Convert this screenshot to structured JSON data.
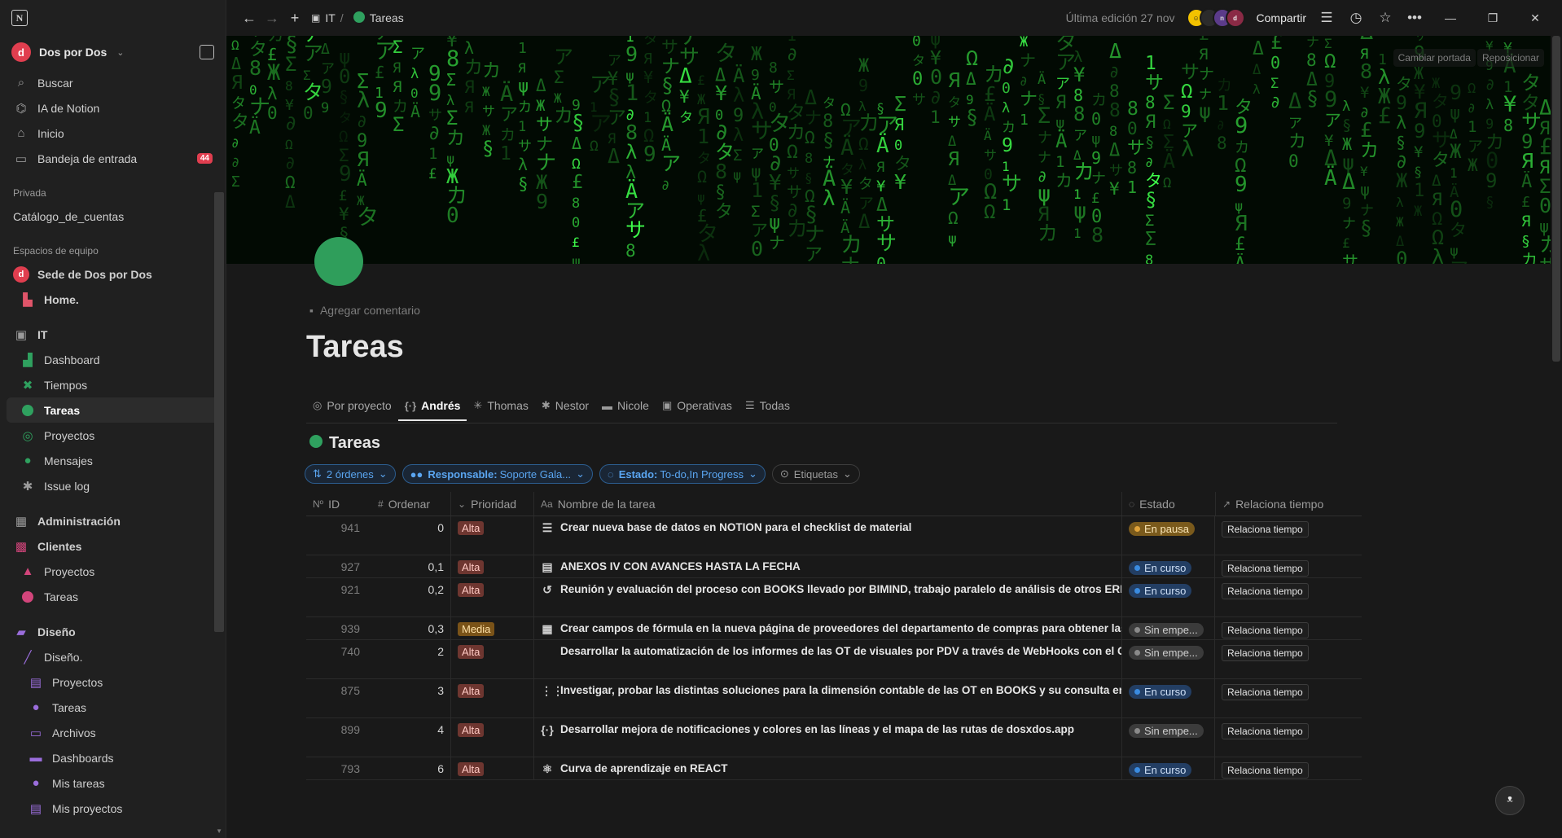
{
  "sidebar": {
    "workspace": "Dos por Dos",
    "top_items": [
      {
        "label": "Buscar",
        "icon": "search-icon"
      },
      {
        "label": "IA de Notion",
        "icon": "ai-icon"
      },
      {
        "label": "Inicio",
        "icon": "home-icon"
      },
      {
        "label": "Bandeja de entrada",
        "icon": "inbox-icon",
        "badge": "44"
      }
    ],
    "private_heading": "Privada",
    "private_items": [
      {
        "label": "Catálogo_de_cuentas"
      }
    ],
    "team_heading": "Espacios de equipo",
    "team_space": "Sede de Dos por Dos",
    "home_item": "Home.",
    "it": "IT",
    "it_items": [
      "Dashboard",
      "Tiempos",
      "Tareas",
      "Proyectos",
      "Mensajes",
      "Issue log"
    ],
    "admin": "Administración",
    "clientes": "Clientes",
    "clientes_items": [
      "Proyectos",
      "Tareas"
    ],
    "diseno": "Diseño",
    "diseno_sub": "Diseño.",
    "diseno_items": [
      "Proyectos",
      "Tareas",
      "Archivos",
      "Dashboards",
      "Mis tareas",
      "Mis proyectos"
    ]
  },
  "topbar": {
    "breadcrumb_parent": "IT",
    "breadcrumb_sep": "/",
    "breadcrumb_current": "Tareas",
    "last_edit": "Última edición 27 nov",
    "share": "Compartir"
  },
  "cover": {
    "change": "Cambiar portada",
    "reposition": "Reposicionar"
  },
  "page": {
    "add_comment": "Agregar comentario",
    "title": "Tareas"
  },
  "tabs": [
    {
      "label": "Por proyecto",
      "icon": "target-icon"
    },
    {
      "label": "Andrés",
      "icon": "code-braces-icon"
    },
    {
      "label": "Thomas",
      "icon": "sparkle-icon"
    },
    {
      "label": "Nestor",
      "icon": "bug-icon"
    },
    {
      "label": "Nicole",
      "icon": "monitor-icon"
    },
    {
      "label": "Operativas",
      "icon": "briefcase-icon"
    },
    {
      "label": "Todas",
      "icon": "database-icon"
    }
  ],
  "database": {
    "title": "Tareas",
    "filters": {
      "sort": "2 órdenes",
      "responsable_label": "Responsable:",
      "responsable_value": "Soporte Gala...",
      "estado_label": "Estado:",
      "estado_value": "To-do,In Progress",
      "etiquetas": "Etiquetas"
    },
    "columns": {
      "id": "ID",
      "ordenar": "Ordenar",
      "prioridad": "Prioridad",
      "nombre": "Nombre de la tarea",
      "estado": "Estado",
      "relaciona": "Relaciona tiempo"
    },
    "rows": [
      {
        "id": "941",
        "ord": "0",
        "pri": "Alta",
        "pri_kind": "alta",
        "icon": "database-icon",
        "name": "Crear nueva base de datos en NOTION para el checklist de material",
        "state": "En pausa",
        "state_kind": "pausa",
        "rel": "Relaciona tiempo",
        "tall": true
      },
      {
        "id": "927",
        "ord": "0,1",
        "pri": "Alta",
        "pri_kind": "alta",
        "icon": "document-icon",
        "name": "ANEXOS IV CON AVANCES HASTA LA FECHA",
        "state": "En curso",
        "state_kind": "curso",
        "rel": "Relaciona tiempo",
        "tall": false
      },
      {
        "id": "921",
        "ord": "0,2",
        "pri": "Alta",
        "pri_kind": "alta",
        "icon": "history-icon",
        "name": "Reunión y evaluación del proceso con BOOKS llevado por BIMIND, trabajo paralelo de análisis de otros ERP que",
        "state": "En curso",
        "state_kind": "curso",
        "rel": "Relaciona tiempo",
        "tall": true
      },
      {
        "id": "939",
        "ord": "0,3",
        "pri": "Media",
        "pri_kind": "media",
        "icon": "calculator-icon",
        "name": "Crear campos de fórmula en la nueva página de proveedores del departamento de compras para obtener las ca",
        "state": "Sin empe...",
        "state_kind": "sin",
        "rel": "Relaciona tiempo",
        "tall": false
      },
      {
        "id": "740",
        "ord": "2",
        "pri": "Alta",
        "pri_kind": "alta",
        "icon": "code-icon",
        "name": "Desarrollar la automatización de los informes de las OT de visuales por PDV a través de WebHooks con el CRM",
        "state": "Sin empe...",
        "state_kind": "sin",
        "rel": "Relaciona tiempo",
        "tall": true
      },
      {
        "id": "875",
        "ord": "3",
        "pri": "Alta",
        "pri_kind": "alta",
        "icon": "grid-icon",
        "name": "Investigar, probar las distintas soluciones para la dimensión contable de las OT en BOOKS y su consulta en ANA",
        "state": "En curso",
        "state_kind": "curso",
        "rel": "Relaciona tiempo",
        "tall": true
      },
      {
        "id": "899",
        "ord": "4",
        "pri": "Alta",
        "pri_kind": "alta",
        "icon": "code-braces-icon",
        "name": "Desarrollar mejora de notificaciones y colores en las líneas y el mapa de las rutas de dosxdos.app",
        "state": "Sin empe...",
        "state_kind": "sin",
        "rel": "Relaciona tiempo",
        "tall": true
      },
      {
        "id": "793",
        "ord": "6",
        "pri": "Alta",
        "pri_kind": "alta",
        "icon": "atom-icon",
        "name": "Curva de aprendizaje en REACT",
        "state": "En curso",
        "state_kind": "curso",
        "rel": "Relaciona tiempo",
        "tall": false
      }
    ]
  },
  "colors": {
    "accent_blue": "#5aa5f0",
    "page_green": "#2f9e5b",
    "badge_red": "#e03e4f"
  }
}
